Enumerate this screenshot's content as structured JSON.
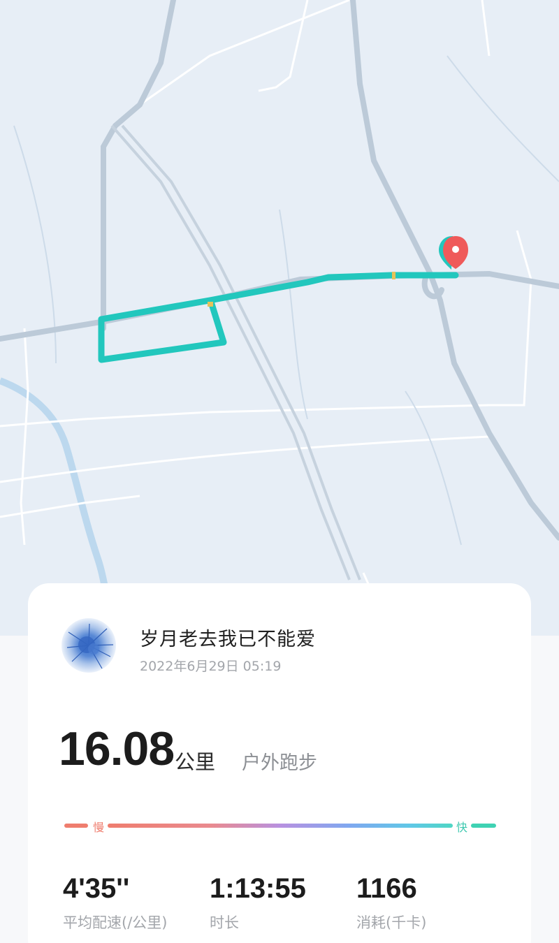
{
  "record": {
    "username": "岁月老去我已不能爱",
    "datetime": "2022年6月29日 05:19",
    "distance": "16.08",
    "distance_unit": "公里",
    "sport_type": "户外跑步"
  },
  "pace_scale": {
    "slow_label": "慢",
    "fast_label": "快"
  },
  "stats": [
    {
      "value": "4'35''",
      "label": "平均配速(/公里)"
    },
    {
      "value": "1:13:55",
      "label": "时长"
    },
    {
      "value": "1166",
      "label": "消耗(千卡)"
    }
  ],
  "colors": {
    "route": "#22c7bd",
    "marker": "#ef5a5a",
    "pace_slow": "#ef7d6e",
    "pace_fast": "#3fd2b3"
  },
  "icons": {
    "marker": "location-pin-icon",
    "avatar": "user-avatar"
  }
}
